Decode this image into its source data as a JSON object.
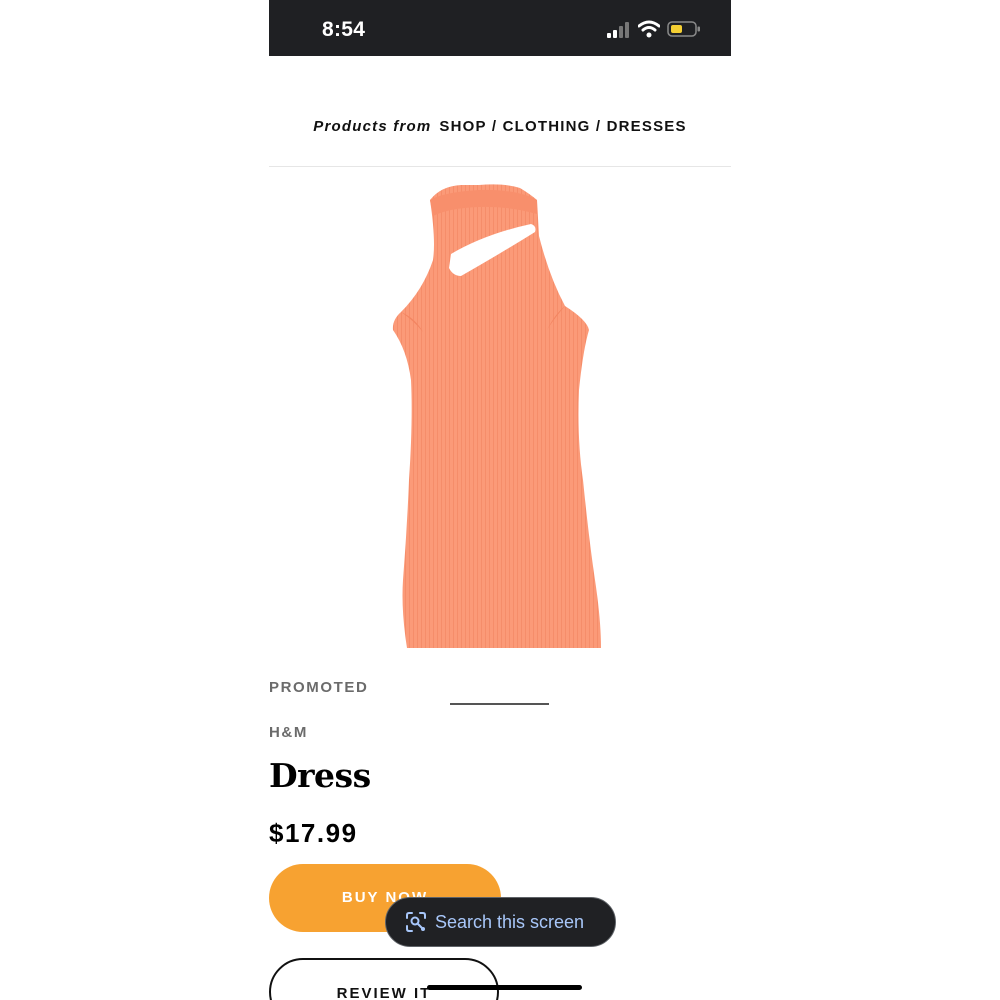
{
  "status_bar": {
    "time": "8:54",
    "icons": [
      "signal-icon",
      "wifi-icon",
      "battery-icon"
    ],
    "battery_color": "#f5d033"
  },
  "breadcrumb": {
    "prefix": "Products from",
    "path": "SHOP / CLOTHING / DRESSES"
  },
  "product": {
    "image": "coral-ribbed-sleeveless-dress",
    "image_color": "#fb9a78",
    "promoted_label": "PROMOTED",
    "brand": "H&M",
    "title": "Dress",
    "price": "$17.99"
  },
  "actions": {
    "buy_now_label": "BUY NOW",
    "buy_now_color": "#f7a231",
    "review_label": "REVIEW IT"
  },
  "overlay": {
    "search_screen_label": "Search this screen",
    "search_screen_icon": "lens-search-icon"
  }
}
